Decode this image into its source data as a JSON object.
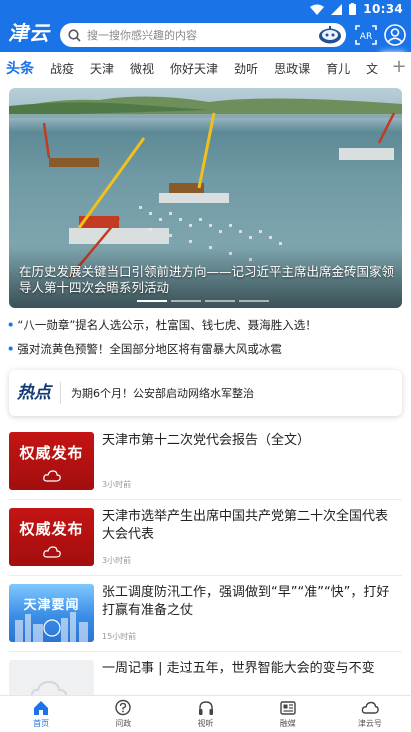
{
  "status": {
    "time": "10:34"
  },
  "header": {
    "logo": "津云",
    "search_placeholder": "搜一搜你感兴趣的内容",
    "ar_label": "AR",
    "accent": "#1a74e8"
  },
  "tabs": [
    {
      "label": "头条",
      "active": true
    },
    {
      "label": "战疫"
    },
    {
      "label": "天津"
    },
    {
      "label": "微视"
    },
    {
      "label": "你好天津"
    },
    {
      "label": "劲听"
    },
    {
      "label": "思政课"
    },
    {
      "label": "育儿"
    },
    {
      "label": "文"
    }
  ],
  "tabs_more": "+",
  "hero": {
    "caption": "在历史发展关键当口引领前进方向——记习近平主席出席金砖国家领导人第十四次会晤系列活动"
  },
  "bullets": [
    {
      "marker": "•",
      "text": "“八一勋章”提名人选公示，杜富国、钱七虎、聂海胜入选！"
    },
    {
      "marker": "•",
      "text": "强对流黄色预警！全国部分地区将有雷暴大风或冰雹"
    }
  ],
  "hot": {
    "logo": "热点",
    "text": "为期6个月！公安部启动网络水军整治"
  },
  "news": [
    {
      "thumb_text": "权威发布",
      "thumb_style": "red",
      "title": "天津市第十二次党代会报告（全文）",
      "time": "3小时前"
    },
    {
      "thumb_text": "权威发布",
      "thumb_style": "red",
      "title": "天津市选举产生出席中国共产党第二十次全国代表大会代表",
      "time": "3小时前"
    },
    {
      "thumb_text": "天津要闻",
      "thumb_style": "blue",
      "title": "张工调度防汛工作，强调做到“早”“准”“快”，打好打赢有准备之仗",
      "time": "15小时前"
    },
    {
      "thumb_text": "",
      "thumb_style": "gray",
      "title": "一周记事 | 走过五年，世界智能大会的变与不变",
      "time": ""
    }
  ],
  "bottom_nav": [
    {
      "label": "首页",
      "icon": "home-icon",
      "active": true
    },
    {
      "label": "问政",
      "icon": "question-bubble-icon"
    },
    {
      "label": "视听",
      "icon": "headphones-icon"
    },
    {
      "label": "融媒",
      "icon": "media-icon"
    },
    {
      "label": "津云号",
      "icon": "cloud-icon"
    }
  ]
}
